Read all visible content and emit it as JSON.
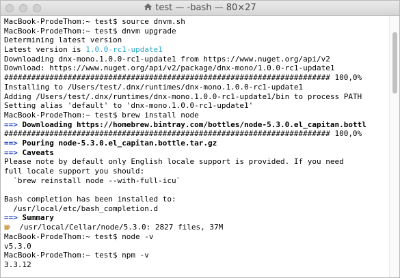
{
  "window": {
    "title": "test — -bash — 80×27",
    "icon": "home-icon"
  },
  "terminal": {
    "lines": [
      {
        "text": "MacBook-ProdeThom:~ test$ source dnvm.sh"
      },
      {
        "text": "MacBook-ProdeThom:~ test$ dnvm upgrade"
      },
      {
        "text": "Determining latest version"
      },
      {
        "prefix": "Latest version is ",
        "highlight": "1.0.0-rc1-update1"
      },
      {
        "text": "Downloading dnx-mono.1.0.0-rc1-update1 from https://www.nuget.org/api/v2"
      },
      {
        "text": "Download: https://www.nuget.org/api/v2/package/dnx-mono/1.0.0-rc1-update1"
      },
      {
        "text": "######################################################################## 100,0%"
      },
      {
        "text": "Installing to /Users/test/.dnx/runtimes/dnx-mono.1.0.0-rc1-update1"
      },
      {
        "text": "Adding /Users/test/.dnx/runtimes/dnx-mono.1.0.0-rc1-update1/bin to process PATH"
      },
      {
        "text": "Setting alias 'default' to 'dnx-mono.1.0.0-rc1-update1'"
      },
      {
        "text": "MacBook-ProdeThom:~ test$ brew install node"
      },
      {
        "arrow": "==>",
        "bold": " Downloading https://homebrew.bintray.com/bottles/node-5.3.0.el_capitan.bottl"
      },
      {
        "text": "######################################################################## 100,0%"
      },
      {
        "arrow": "==>",
        "bold": " Pouring node-5.3.0.el_capitan.bottle.tar.gz"
      },
      {
        "arrow": "==>",
        "bold": " Caveats"
      },
      {
        "text": "Please note by default only English locale support is provided. If you need"
      },
      {
        "text": "full locale support you should:"
      },
      {
        "text": "  `brew reinstall node --with-full-icu`"
      },
      {
        "text": ""
      },
      {
        "text": "Bash completion has been installed to:"
      },
      {
        "text": "  /usr/local/etc/bash_completion.d"
      },
      {
        "arrow": "==>",
        "bold": " Summary"
      },
      {
        "beer": true,
        "text": "  /usr/local/Cellar/node/5.3.0: 2827 files, 37M"
      },
      {
        "text": "MacBook-ProdeThom:~ test$ node -v"
      },
      {
        "text": "v5.3.0"
      },
      {
        "text": "MacBook-ProdeThom:~ test$ npm -v"
      },
      {
        "text": "3.3.12"
      }
    ]
  }
}
